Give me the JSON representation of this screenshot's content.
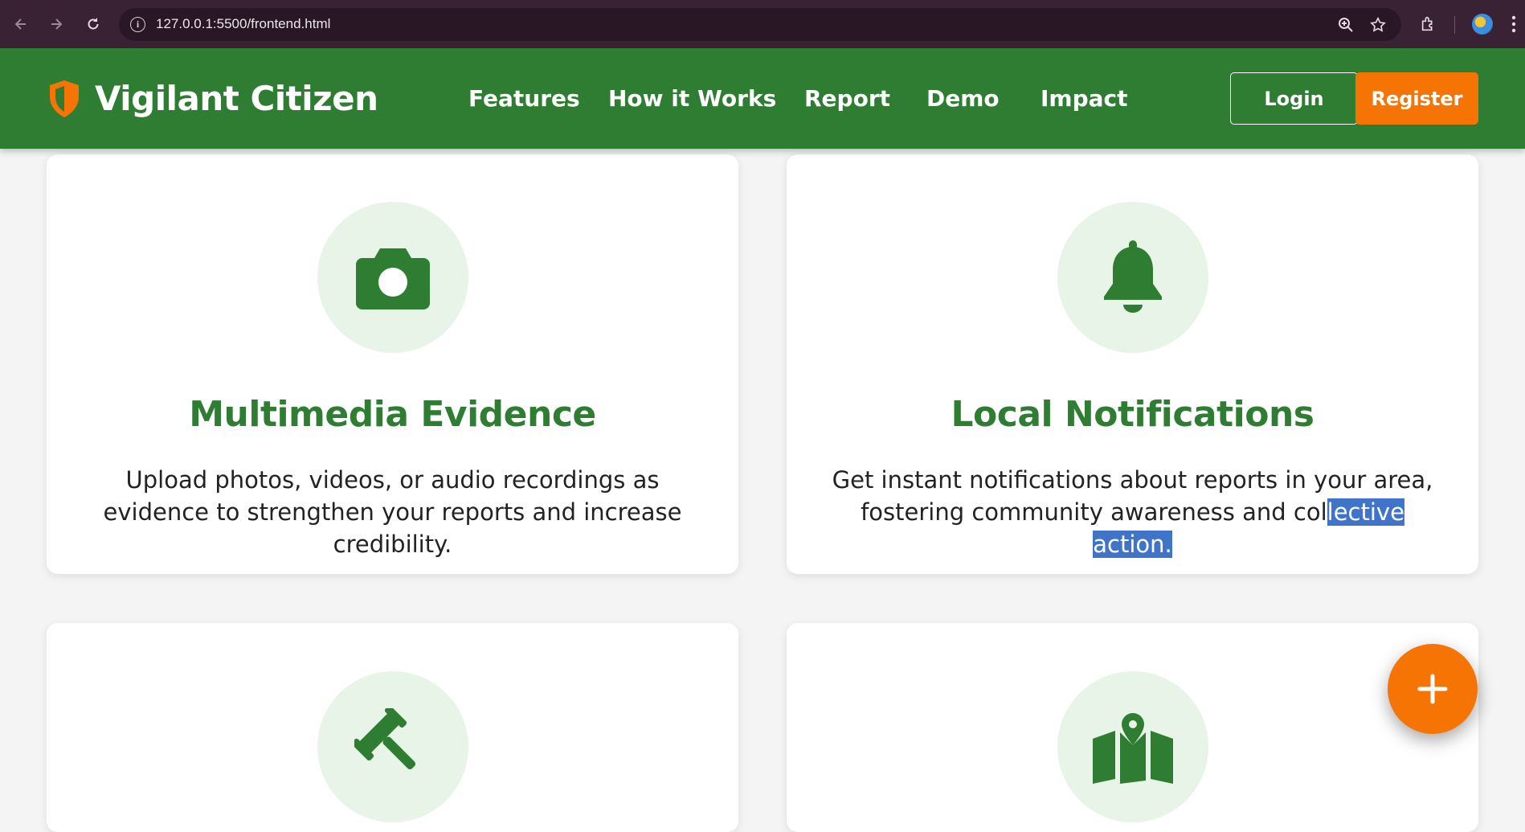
{
  "browser": {
    "url": "127.0.0.1:5500/frontend.html",
    "back_icon": "arrow-left",
    "forward_icon": "arrow-right",
    "reload_icon": "reload"
  },
  "header": {
    "brand_name": "Vigilant Citizen",
    "nav": [
      "Features",
      "How it Works",
      "Report",
      "Demo",
      "Impact"
    ],
    "login_label": "Login",
    "register_label": "Register"
  },
  "colors": {
    "brand_green": "#2e7d32",
    "accent_orange": "#f57404",
    "icon_circle": "#e7f4e7"
  },
  "features": [
    {
      "icon": "camera-icon",
      "title": "Multimedia Evidence",
      "text": "Upload photos, videos, or audio recordings as evidence to strengthen your reports and increase credibility."
    },
    {
      "icon": "bell-icon",
      "title": "Local Notifications",
      "text_line1": "Get instant notifications about reports in your area,",
      "text_line2_plain": "fostering community awareness and col",
      "text_line2_selected": "lective action."
    },
    {
      "icon": "gavel-icon"
    },
    {
      "icon": "map-icon"
    }
  ],
  "fab_icon": "plus-icon"
}
